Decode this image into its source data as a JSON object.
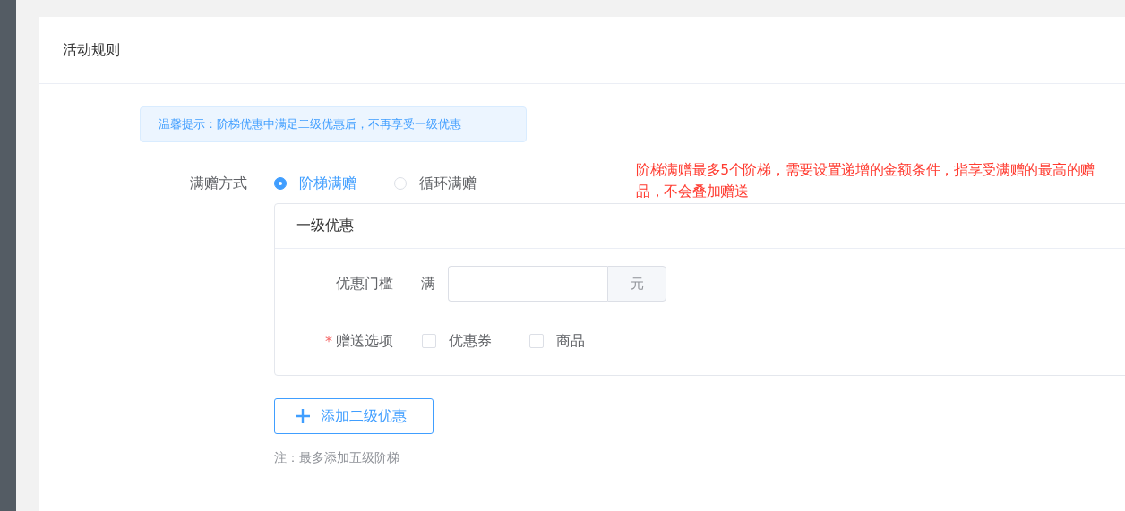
{
  "panel": {
    "title": "活动规则"
  },
  "tip": "温馨提示：阶梯优惠中满足二级优惠后，不再享受一级优惠",
  "gift_mode": {
    "label": "满赠方式",
    "options": [
      {
        "label": "阶梯满赠",
        "selected": true
      },
      {
        "label": "循环满赠",
        "selected": false
      }
    ],
    "note": "阶梯满赠最多5个阶梯，需要设置递增的金额条件，指享受满赠的最高的赠品，不会叠加赠送"
  },
  "tier": {
    "title": "一级优惠",
    "threshold": {
      "label": "优惠门槛",
      "prefix": "满",
      "suffix": "元"
    },
    "gift_options": {
      "label": "赠送选项",
      "required_mark": "*",
      "options": [
        {
          "label": "优惠券",
          "checked": false
        },
        {
          "label": "商品",
          "checked": false
        }
      ]
    }
  },
  "add_button": "添加二级优惠",
  "footnote": "注：最多添加五级阶梯"
}
